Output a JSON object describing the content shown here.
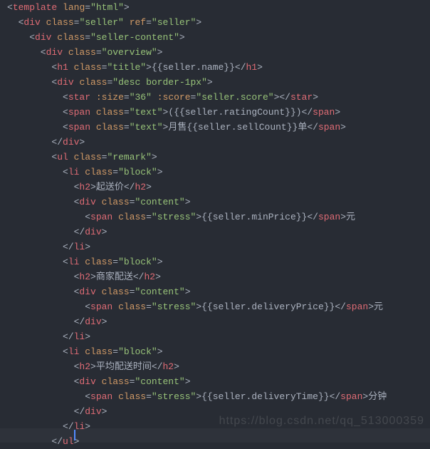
{
  "watermark": "https://blog.csdn.net/qq_513000359",
  "lines": [
    [
      [
        "p",
        "<"
      ],
      [
        "t",
        "template"
      ],
      [
        "p",
        " "
      ],
      [
        "a",
        "lang"
      ],
      [
        "p",
        "="
      ],
      [
        "s",
        "\"html\""
      ],
      [
        "p",
        ">"
      ]
    ],
    [
      [
        "p",
        "  <"
      ],
      [
        "t",
        "div"
      ],
      [
        "p",
        " "
      ],
      [
        "a",
        "class"
      ],
      [
        "p",
        "="
      ],
      [
        "s",
        "\"seller\""
      ],
      [
        "p",
        " "
      ],
      [
        "a",
        "ref"
      ],
      [
        "p",
        "="
      ],
      [
        "s",
        "\"seller\""
      ],
      [
        "p",
        ">"
      ]
    ],
    [
      [
        "p",
        "    <"
      ],
      [
        "t",
        "div"
      ],
      [
        "p",
        " "
      ],
      [
        "a",
        "class"
      ],
      [
        "p",
        "="
      ],
      [
        "s",
        "\"seller-content\""
      ],
      [
        "p",
        ">"
      ]
    ],
    [
      [
        "p",
        "      <"
      ],
      [
        "t",
        "div"
      ],
      [
        "p",
        " "
      ],
      [
        "a",
        "class"
      ],
      [
        "p",
        "="
      ],
      [
        "s",
        "\"overview\""
      ],
      [
        "p",
        ">"
      ]
    ],
    [
      [
        "p",
        "        <"
      ],
      [
        "t",
        "h1"
      ],
      [
        "p",
        " "
      ],
      [
        "a",
        "class"
      ],
      [
        "p",
        "="
      ],
      [
        "s",
        "\"title\""
      ],
      [
        "p",
        ">"
      ],
      [
        "tx",
        "{{seller.name}}"
      ],
      [
        "p",
        "</"
      ],
      [
        "t",
        "h1"
      ],
      [
        "p",
        ">"
      ]
    ],
    [
      [
        "p",
        "        <"
      ],
      [
        "t",
        "div"
      ],
      [
        "p",
        " "
      ],
      [
        "a",
        "class"
      ],
      [
        "p",
        "="
      ],
      [
        "s",
        "\"desc border-1px\""
      ],
      [
        "p",
        ">"
      ]
    ],
    [
      [
        "p",
        "          <"
      ],
      [
        "t",
        "star"
      ],
      [
        "p",
        " "
      ],
      [
        "a",
        ":size"
      ],
      [
        "p",
        "="
      ],
      [
        "s",
        "\"36\""
      ],
      [
        "p",
        " "
      ],
      [
        "a",
        ":score"
      ],
      [
        "p",
        "="
      ],
      [
        "s",
        "\"seller.score\""
      ],
      [
        "p",
        "></"
      ],
      [
        "t",
        "star"
      ],
      [
        "p",
        ">"
      ]
    ],
    [
      [
        "p",
        "          <"
      ],
      [
        "t",
        "span"
      ],
      [
        "p",
        " "
      ],
      [
        "a",
        "class"
      ],
      [
        "p",
        "="
      ],
      [
        "s",
        "\"text\""
      ],
      [
        "p",
        ">"
      ],
      [
        "tx",
        "({{seller.ratingCount}})"
      ],
      [
        "p",
        "</"
      ],
      [
        "t",
        "span"
      ],
      [
        "p",
        ">"
      ]
    ],
    [
      [
        "p",
        "          <"
      ],
      [
        "t",
        "span"
      ],
      [
        "p",
        " "
      ],
      [
        "a",
        "class"
      ],
      [
        "p",
        "="
      ],
      [
        "s",
        "\"text\""
      ],
      [
        "p",
        ">"
      ],
      [
        "tx",
        "月售{{seller.sellCount}}单"
      ],
      [
        "p",
        "</"
      ],
      [
        "t",
        "span"
      ],
      [
        "p",
        ">"
      ]
    ],
    [
      [
        "p",
        "        </"
      ],
      [
        "t",
        "div"
      ],
      [
        "p",
        ">"
      ]
    ],
    [
      [
        "p",
        "        <"
      ],
      [
        "t",
        "ul"
      ],
      [
        "p",
        " "
      ],
      [
        "a",
        "class"
      ],
      [
        "p",
        "="
      ],
      [
        "s",
        "\"remark\""
      ],
      [
        "p",
        ">"
      ]
    ],
    [
      [
        "p",
        "          <"
      ],
      [
        "t",
        "li"
      ],
      [
        "p",
        " "
      ],
      [
        "a",
        "class"
      ],
      [
        "p",
        "="
      ],
      [
        "s",
        "\"block\""
      ],
      [
        "p",
        ">"
      ]
    ],
    [
      [
        "p",
        "            <"
      ],
      [
        "t",
        "h2"
      ],
      [
        "p",
        ">"
      ],
      [
        "tx",
        "起送价"
      ],
      [
        "p",
        "</"
      ],
      [
        "t",
        "h2"
      ],
      [
        "p",
        ">"
      ]
    ],
    [
      [
        "p",
        "            <"
      ],
      [
        "t",
        "div"
      ],
      [
        "p",
        " "
      ],
      [
        "a",
        "class"
      ],
      [
        "p",
        "="
      ],
      [
        "s",
        "\"content\""
      ],
      [
        "p",
        ">"
      ]
    ],
    [
      [
        "p",
        "              <"
      ],
      [
        "t",
        "span"
      ],
      [
        "p",
        " "
      ],
      [
        "a",
        "class"
      ],
      [
        "p",
        "="
      ],
      [
        "s",
        "\"stress\""
      ],
      [
        "p",
        ">"
      ],
      [
        "tx",
        "{{seller.minPrice}}"
      ],
      [
        "p",
        "</"
      ],
      [
        "t",
        "span"
      ],
      [
        "p",
        ">"
      ],
      [
        "tx",
        "元"
      ]
    ],
    [
      [
        "p",
        "            </"
      ],
      [
        "t",
        "div"
      ],
      [
        "p",
        ">"
      ]
    ],
    [
      [
        "p",
        "          </"
      ],
      [
        "t",
        "li"
      ],
      [
        "p",
        ">"
      ]
    ],
    [
      [
        "p",
        "          <"
      ],
      [
        "t",
        "li"
      ],
      [
        "p",
        " "
      ],
      [
        "a",
        "class"
      ],
      [
        "p",
        "="
      ],
      [
        "s",
        "\"block\""
      ],
      [
        "p",
        ">"
      ]
    ],
    [
      [
        "p",
        "            <"
      ],
      [
        "t",
        "h2"
      ],
      [
        "p",
        ">"
      ],
      [
        "tx",
        "商家配送"
      ],
      [
        "p",
        "</"
      ],
      [
        "t",
        "h2"
      ],
      [
        "p",
        ">"
      ]
    ],
    [
      [
        "p",
        "            <"
      ],
      [
        "t",
        "div"
      ],
      [
        "p",
        " "
      ],
      [
        "a",
        "class"
      ],
      [
        "p",
        "="
      ],
      [
        "s",
        "\"content\""
      ],
      [
        "p",
        ">"
      ]
    ],
    [
      [
        "p",
        "              <"
      ],
      [
        "t",
        "span"
      ],
      [
        "p",
        " "
      ],
      [
        "a",
        "class"
      ],
      [
        "p",
        "="
      ],
      [
        "s",
        "\"stress\""
      ],
      [
        "p",
        ">"
      ],
      [
        "tx",
        "{{seller.deliveryPrice}}"
      ],
      [
        "p",
        "</"
      ],
      [
        "t",
        "span"
      ],
      [
        "p",
        ">"
      ],
      [
        "tx",
        "元"
      ]
    ],
    [
      [
        "p",
        "            </"
      ],
      [
        "t",
        "div"
      ],
      [
        "p",
        ">"
      ]
    ],
    [
      [
        "p",
        "          </"
      ],
      [
        "t",
        "li"
      ],
      [
        "p",
        ">"
      ]
    ],
    [
      [
        "p",
        "          <"
      ],
      [
        "t",
        "li"
      ],
      [
        "p",
        " "
      ],
      [
        "a",
        "class"
      ],
      [
        "p",
        "="
      ],
      [
        "s",
        "\"block\""
      ],
      [
        "p",
        ">"
      ]
    ],
    [
      [
        "p",
        "            <"
      ],
      [
        "t",
        "h2"
      ],
      [
        "p",
        ">"
      ],
      [
        "tx",
        "平均配送时间"
      ],
      [
        "p",
        "</"
      ],
      [
        "t",
        "h2"
      ],
      [
        "p",
        ">"
      ]
    ],
    [
      [
        "p",
        "            <"
      ],
      [
        "t",
        "div"
      ],
      [
        "p",
        " "
      ],
      [
        "a",
        "class"
      ],
      [
        "p",
        "="
      ],
      [
        "s",
        "\"content\""
      ],
      [
        "p",
        ">"
      ]
    ],
    [
      [
        "p",
        "              <"
      ],
      [
        "t",
        "span"
      ],
      [
        "p",
        " "
      ],
      [
        "a",
        "class"
      ],
      [
        "p",
        "="
      ],
      [
        "s",
        "\"stress\""
      ],
      [
        "p",
        ">"
      ],
      [
        "tx",
        "{{seller.deliveryTime}}"
      ],
      [
        "p",
        "</"
      ],
      [
        "t",
        "span"
      ],
      [
        "p",
        ">"
      ],
      [
        "tx",
        "分钟"
      ]
    ],
    [
      [
        "p",
        "            </"
      ],
      [
        "t",
        "div"
      ],
      [
        "p",
        ">"
      ]
    ],
    [
      [
        "p",
        "          </"
      ],
      [
        "t",
        "li"
      ],
      [
        "p",
        ">"
      ]
    ],
    [
      [
        "p",
        "        </"
      ],
      [
        "t",
        "ul"
      ],
      [
        "p",
        ">"
      ]
    ]
  ]
}
